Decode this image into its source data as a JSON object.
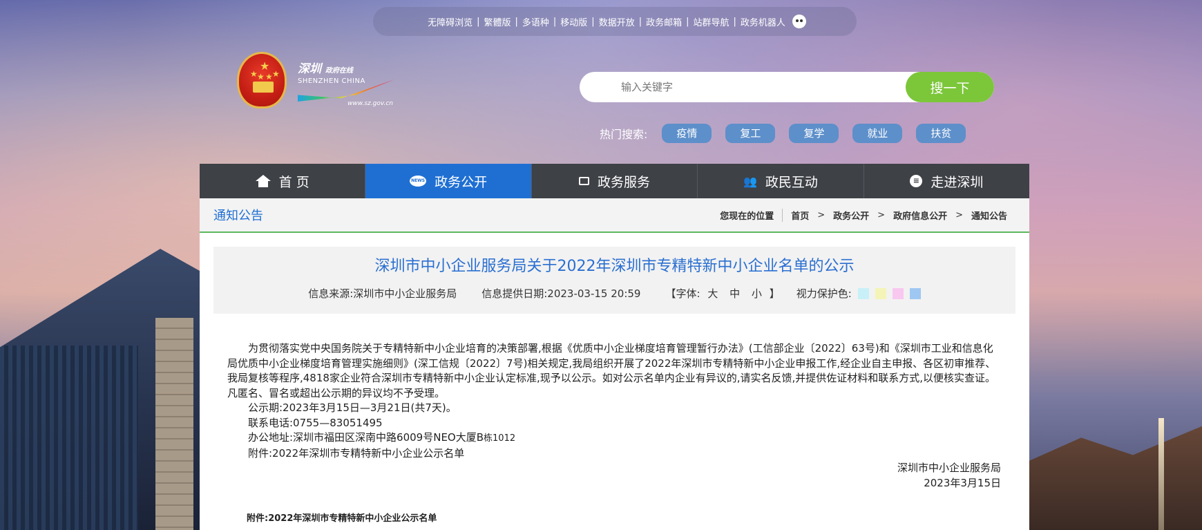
{
  "topbar": {
    "links": [
      "无障碍浏览",
      "繁體版",
      "多语种",
      "移动版",
      "数据开放",
      "政务邮箱",
      "站群导航",
      "政务机器人"
    ]
  },
  "logo": {
    "cn_main": "深圳",
    "cn_sub": "政府在线",
    "en": "SHENZHEN CHINA",
    "url": "www.sz.gov.cn"
  },
  "search": {
    "placeholder": "输入关键字",
    "button": "搜一下"
  },
  "hot_search": {
    "label": "热门搜索:",
    "tags": [
      "疫情",
      "复工",
      "复学",
      "就业",
      "扶贫"
    ]
  },
  "nav": {
    "items": [
      {
        "label": "首 页",
        "icon": "home-icon"
      },
      {
        "label": "政务公开",
        "icon": "news-icon"
      },
      {
        "label": "政务服务",
        "icon": "monitor-icon"
      },
      {
        "label": "政民互动",
        "icon": "people-icon"
      },
      {
        "label": "走进深圳",
        "icon": "chat-icon"
      }
    ],
    "active_index": 1
  },
  "breadcrumb": {
    "section_title": "通知公告",
    "here": "您现在的位置",
    "items": [
      "首页",
      "政务公开",
      "政府信息公开",
      "通知公告"
    ]
  },
  "article": {
    "title": "深圳市中小企业服务局关于2022年深圳市专精特新中小企业名单的公示",
    "source": "信息来源:深圳市中小企业服务局",
    "date": "信息提供日期:2023-03-15 20:59",
    "font_label": "【字体:",
    "font_sizes": [
      "大",
      "中",
      "小"
    ],
    "font_end": "】",
    "eye_label": "视力保护色:",
    "eye_colors": [
      "#c8f0f8",
      "#f4f4b8",
      "#f8c8f0",
      "#9ec8f2"
    ],
    "paragraph": "为贯彻落实党中央国务院关于专精特新中小企业培育的决策部署,根据《优质中小企业梯度培育管理暂行办法》(工信部企业〔2022〕63号)和《深圳市工业和信息化局优质中小企业梯度培育管理实施细则》(深工信规〔2022〕7号)相关规定,我局组织开展了2022年深圳市专精特新中小企业申报工作,经企业自主申报、各区初审推荐、我局复核等程序,4818家企业符合深圳市专精特新中小企业认定标准,现予以公示。如对公示名单内企业有异议的,请实名反馈,并提供佐证材料和联系方式,以便核实查证。凡匿名、冒名或超出公示期的异议均不予受理。",
    "period": "公示期:2023年3月15日—3月21日(共7天)。",
    "phone": "联系电话:0755—83051495",
    "address_main": "办公地址:深圳市福田区深南中路6009号NEO大厦B",
    "address_small": "栋1012",
    "attachment": "附件:2022年深圳市专精特新中小企业公示名单",
    "signer": "深圳市中小企业服务局",
    "sign_date": "2023年3月15日",
    "attachment_bold": "附件:2022年深圳市专精特新中小企业公示名单"
  }
}
